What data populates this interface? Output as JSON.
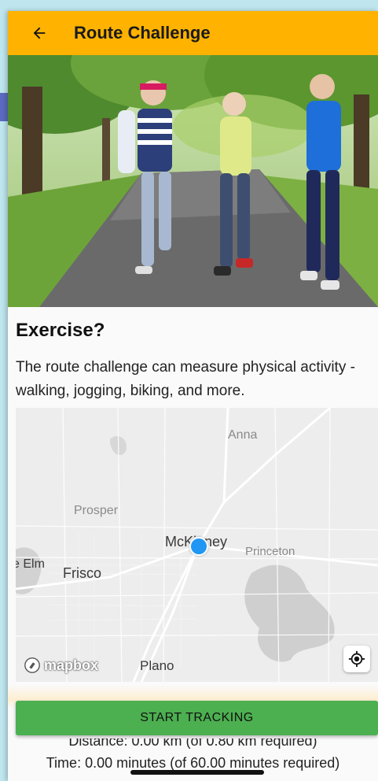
{
  "appbar": {
    "title": "Route Challenge",
    "back_icon": "arrow-back-icon"
  },
  "hero": {
    "description": "three seniors jogging on a tree-lined path"
  },
  "content": {
    "heading": "Exercise?",
    "description": "The route challenge can measure physical activity - walking, jogging, biking, and more."
  },
  "map": {
    "labels": {
      "anna": "Anna",
      "prosper": "Prosper",
      "mckinney": "McKinney",
      "princeton": "Princeton",
      "elm": "e Elm",
      "frisco": "Frisco",
      "plano": "Plano"
    },
    "attribution": "mapbox",
    "locate_icon": "my-location-icon"
  },
  "actions": {
    "start_tracking": "START TRACKING"
  },
  "stats": {
    "distance": "Distance: 0.00 km (of 0.80 km required)",
    "time": "Time: 0.00 minutes (of 60.00 minutes required)"
  },
  "colors": {
    "appbar": "#ffb300",
    "button": "#4caf50",
    "user_dot": "#2196f3"
  }
}
